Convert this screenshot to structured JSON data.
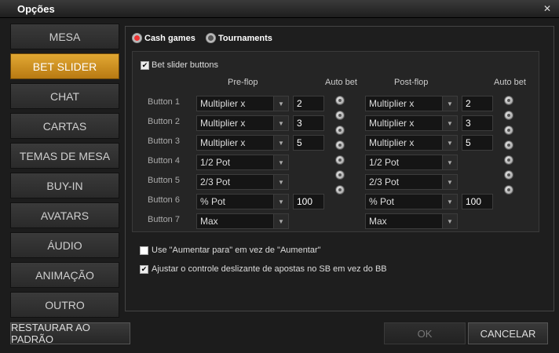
{
  "window": {
    "title": "Opções"
  },
  "tabs": [
    {
      "label": "MESA"
    },
    {
      "label": "BET SLIDER"
    },
    {
      "label": "CHAT"
    },
    {
      "label": "CARTAS"
    },
    {
      "label": "TEMAS DE MESA"
    },
    {
      "label": "BUY-IN"
    },
    {
      "label": "AVATARS"
    },
    {
      "label": "ÁUDIO"
    },
    {
      "label": "ANIMAÇÃO"
    },
    {
      "label": "OUTRO"
    }
  ],
  "active_tab": "BET SLIDER",
  "mode": {
    "cash": "Cash games",
    "tournaments": "Tournaments",
    "selected": "Cash games"
  },
  "bet_slider_buttons": "Bet slider buttons",
  "headers": {
    "preflop": "Pre-flop",
    "postflop": "Post-flop",
    "autobet": "Auto bet"
  },
  "rows": [
    {
      "label": "Button 1",
      "pre": "Multiplier x",
      "pre_val": "2",
      "post": "Multiplier x",
      "post_val": "2"
    },
    {
      "label": "Button 2",
      "pre": "Multiplier x",
      "pre_val": "3",
      "post": "Multiplier x",
      "post_val": "3"
    },
    {
      "label": "Button 3",
      "pre": "Multiplier x",
      "pre_val": "5",
      "post": "Multiplier x",
      "post_val": "5"
    },
    {
      "label": "Button 4",
      "pre": "1/2 Pot",
      "pre_val": "",
      "post": "1/2 Pot",
      "post_val": ""
    },
    {
      "label": "Button 5",
      "pre": "2/3 Pot",
      "pre_val": "",
      "post": "2/3 Pot",
      "post_val": ""
    },
    {
      "label": "Button 6",
      "pre": "% Pot",
      "pre_val": "100",
      "post": "% Pot",
      "post_val": "100"
    },
    {
      "label": "Button 7",
      "pre": "Max",
      "pre_val": "",
      "post": "Max",
      "post_val": ""
    }
  ],
  "opt_raise_to": "Use \"Aumentar para\" em vez de \"Aumentar\"",
  "opt_sb": "Ajustar o controle deslizante de apostas no SB em vez do BB",
  "buttons": {
    "restore": "RESTAURAR AO PADRÃO",
    "ok": "OK",
    "cancel": "CANCELAR"
  }
}
